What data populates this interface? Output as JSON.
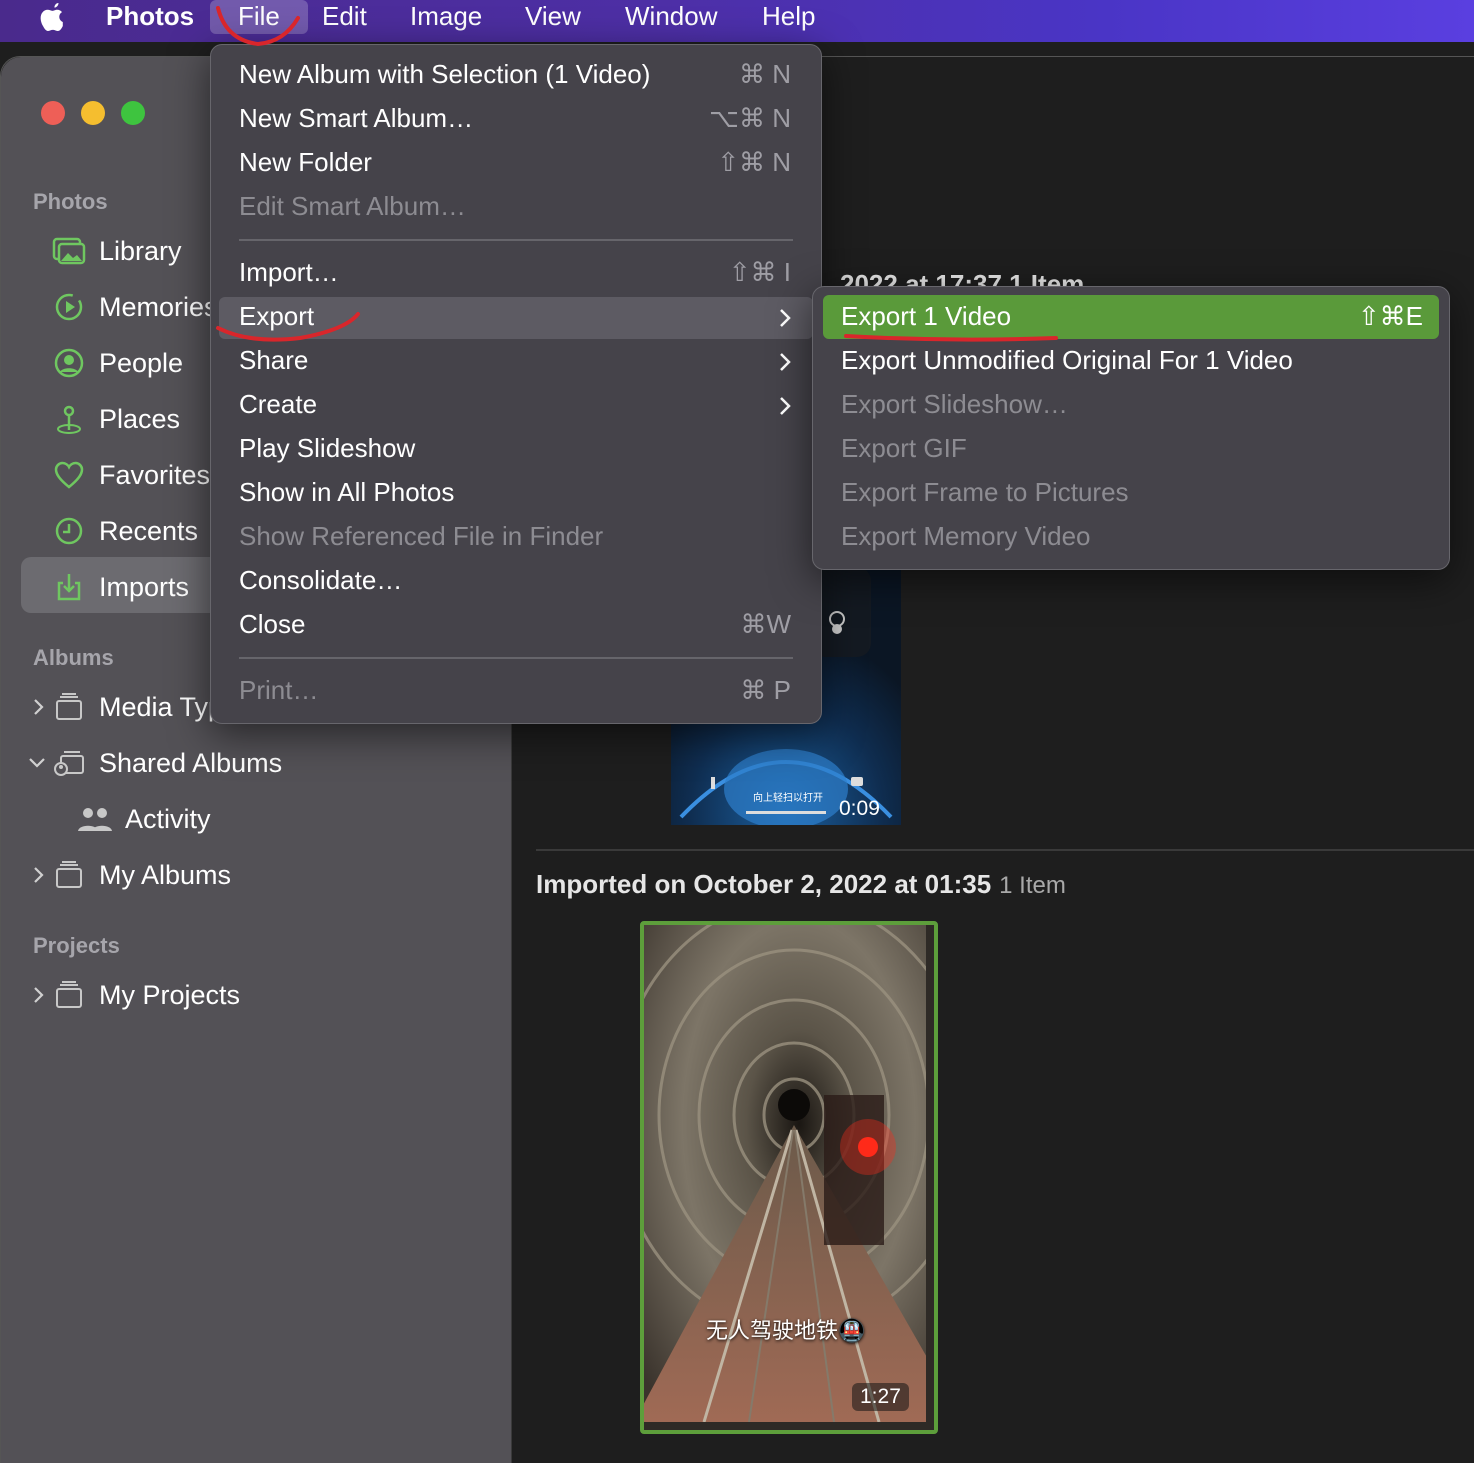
{
  "menubar": {
    "app_name": "Photos",
    "items": [
      "File",
      "Edit",
      "Image",
      "View",
      "Window",
      "Help"
    ]
  },
  "sidebar": {
    "section_photos": "Photos",
    "items": [
      "Library",
      "Memories",
      "People",
      "Places",
      "Favorites",
      "Recents",
      "Imports"
    ],
    "section_albums": "Albums",
    "albums": [
      "Media Types",
      "Shared Albums",
      "Activity",
      "My Albums"
    ],
    "section_projects": "Projects",
    "projects": [
      "My Projects"
    ]
  },
  "content": {
    "partial_header": "2022 at 17:37  1 Item",
    "top_thumb_duration": "0:09",
    "top_thumb_caption": "向上轻扫以打开",
    "import2_title": "Imported on October 2, 2022 at 01:35",
    "import2_count": "1 Item",
    "main_thumb_caption": "无人驾驶地铁🚇",
    "main_thumb_duration": "1:27"
  },
  "file_menu": {
    "items": [
      {
        "label": "New Album with Selection (1 Video)",
        "shortcut": "⌘ N"
      },
      {
        "label": "New Smart Album…",
        "shortcut": "⌥⌘ N"
      },
      {
        "label": "New Folder",
        "shortcut": "⇧⌘ N"
      },
      {
        "label": "Edit Smart Album…",
        "shortcut": ""
      },
      {
        "label": "Import…",
        "shortcut": "⇧⌘ I"
      },
      {
        "label": "Export",
        "shortcut": ""
      },
      {
        "label": "Share",
        "shortcut": ""
      },
      {
        "label": "Create",
        "shortcut": ""
      },
      {
        "label": "Play Slideshow",
        "shortcut": ""
      },
      {
        "label": "Show in All Photos",
        "shortcut": ""
      },
      {
        "label": "Show Referenced File in Finder",
        "shortcut": ""
      },
      {
        "label": "Consolidate…",
        "shortcut": ""
      },
      {
        "label": "Close",
        "shortcut": "⌘W"
      },
      {
        "label": "Print…",
        "shortcut": "⌘ P"
      }
    ]
  },
  "export_submenu": {
    "items": [
      {
        "label": "Export 1 Video",
        "shortcut": "⇧⌘E"
      },
      {
        "label": "Export Unmodified Original For 1 Video",
        "shortcut": ""
      },
      {
        "label": "Export Slideshow…",
        "shortcut": ""
      },
      {
        "label": "Export GIF",
        "shortcut": ""
      },
      {
        "label": "Export Frame to Pictures",
        "shortcut": ""
      },
      {
        "label": "Export Memory Video",
        "shortcut": ""
      }
    ]
  },
  "colors": {
    "accent_green": "#5a9a3a",
    "annotation_red": "#d9262b",
    "sidebar_icon": "#6fc760"
  }
}
